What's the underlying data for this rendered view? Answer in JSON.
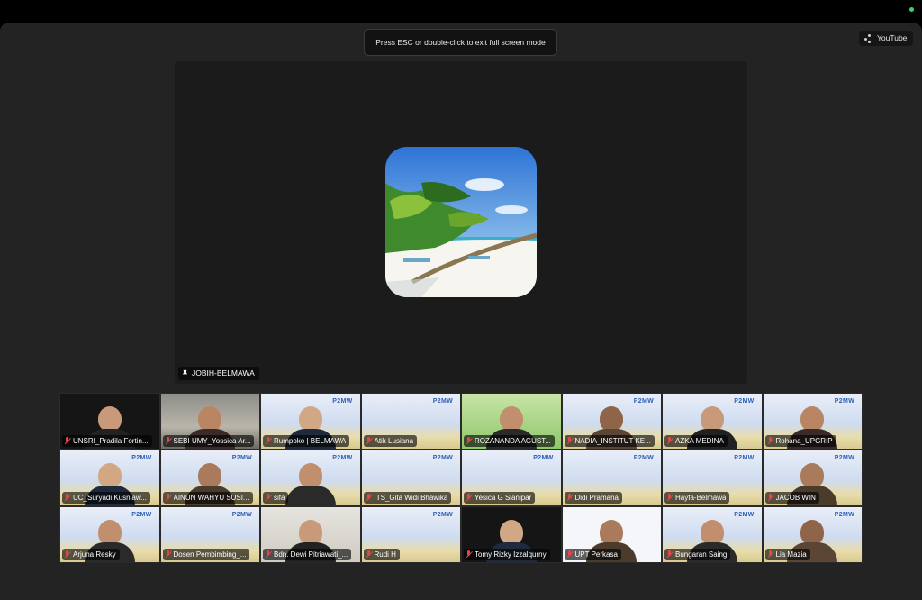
{
  "toast": {
    "text": "Press ESC or double-click to exit full screen mode"
  },
  "youtube": {
    "label": "YouTube"
  },
  "speaker": {
    "name": "JOBIH-BELMAWA",
    "icon": "pin-icon"
  },
  "colors": {
    "window_bg": "#232323",
    "speaker_bg": "#1b1b1b",
    "muted_mic": "#e04848",
    "camera_indicator": "#3bd16f"
  },
  "participants": [
    {
      "name": "UNSRI_Pradila Fortin...",
      "bg": "dark",
      "muted": true
    },
    {
      "name": "SEBI UMY_Yossica Ar...",
      "bg": "room",
      "muted": true
    },
    {
      "name": "Rumpoko | BELMAWA",
      "bg": "p2mw",
      "muted": true
    },
    {
      "name": "Atik Lusiana",
      "bg": "p2mw",
      "muted": true
    },
    {
      "name": "ROZANANDA AGUST...",
      "bg": "green",
      "muted": true
    },
    {
      "name": "NADIA_INSTITUT KE...",
      "bg": "p2mw",
      "muted": true
    },
    {
      "name": "AZKA MEDINA",
      "bg": "p2mw",
      "muted": true
    },
    {
      "name": "Rohana_UPGRIP",
      "bg": "p2mw",
      "muted": true
    },
    {
      "name": "UC_Suryadi Kusniaw...",
      "bg": "p2mw",
      "muted": true
    },
    {
      "name": "AINUN WAHYU SUSI...",
      "bg": "p2mw",
      "muted": true
    },
    {
      "name": "sifa",
      "bg": "p2mw",
      "muted": true
    },
    {
      "name": "ITS_Gita Widi Bhawika",
      "bg": "p2mw",
      "muted": true
    },
    {
      "name": "Yesica G Sianipar",
      "bg": "p2mw",
      "muted": true
    },
    {
      "name": "Didi Pramana",
      "bg": "p2mw",
      "muted": true
    },
    {
      "name": "Hayfa-Belmawa",
      "bg": "p2mw",
      "muted": true
    },
    {
      "name": "JACOB WIN",
      "bg": "p2mw",
      "muted": true
    },
    {
      "name": "Arjuna Resky",
      "bg": "p2mw",
      "muted": true
    },
    {
      "name": "Dosen Pembimbing_...",
      "bg": "p2mw",
      "muted": true
    },
    {
      "name": "Bdn. Dewi Pitriawati_...",
      "bg": "offwhite",
      "muted": true
    },
    {
      "name": "Rudi H",
      "bg": "p2mw",
      "muted": true
    },
    {
      "name": "Tomy Rizky Izzalqurny",
      "bg": "dark",
      "muted": true
    },
    {
      "name": "UPT Perkasa",
      "bg": "white",
      "muted": true
    },
    {
      "name": "Bungaran Saing",
      "bg": "p2mw",
      "muted": true
    },
    {
      "name": "Lia Mazia",
      "bg": "p2mw",
      "muted": true
    }
  ],
  "background_logo": "P2MW"
}
